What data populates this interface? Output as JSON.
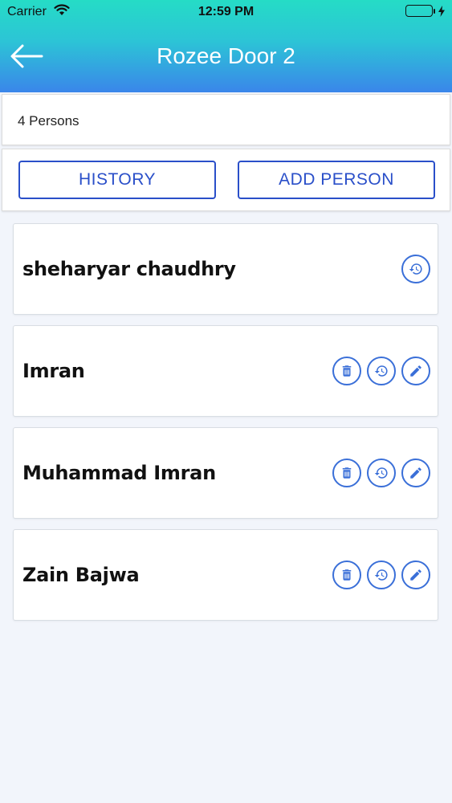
{
  "status_bar": {
    "carrier": "Carrier",
    "time": "12:59 PM"
  },
  "header": {
    "title": "Rozee Door 2",
    "back_icon": "arrow-left-icon"
  },
  "count_label": "4 Persons",
  "actions": {
    "history_label": "HISTORY",
    "add_person_label": "ADD PERSON"
  },
  "persons": [
    {
      "name": "sheharyar chaudhry",
      "actions": [
        "history"
      ]
    },
    {
      "name": "Imran",
      "actions": [
        "delete",
        "history",
        "edit"
      ]
    },
    {
      "name": "Muhammad Imran",
      "actions": [
        "delete",
        "history",
        "edit"
      ]
    },
    {
      "name": "Zain Bajwa",
      "actions": [
        "delete",
        "history",
        "edit"
      ]
    }
  ],
  "colors": {
    "accent": "#2a4fc9",
    "icon_accent": "#3a6fd8",
    "header_gradient_top": "#25dcc6",
    "header_gradient_bottom": "#3a86ea",
    "battery": "#35c759"
  }
}
